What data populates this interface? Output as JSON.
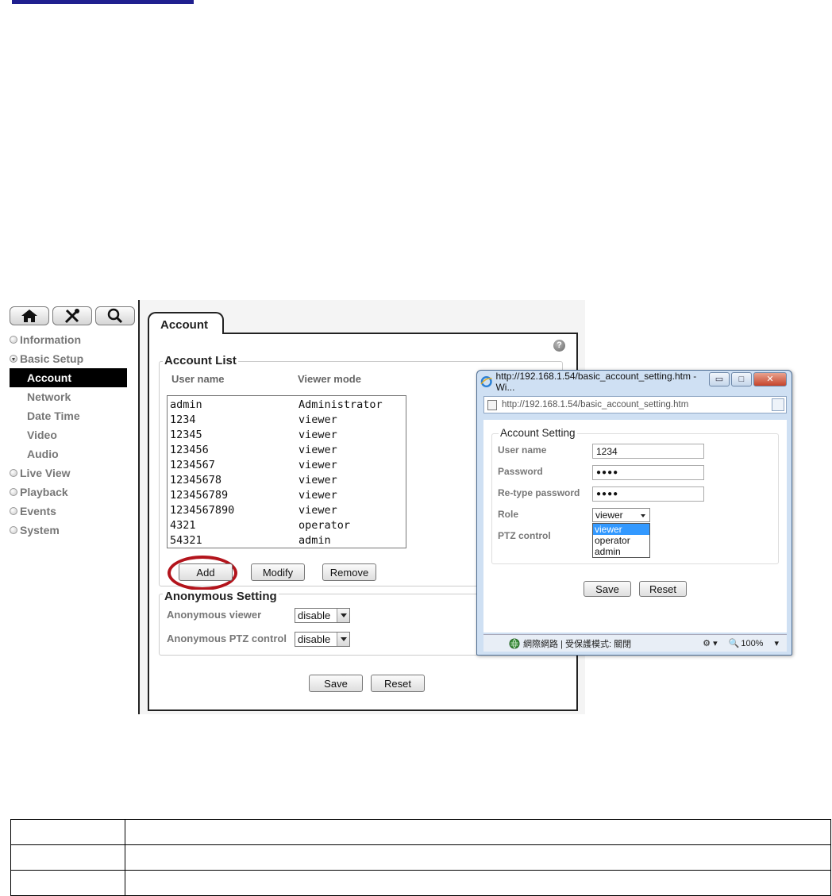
{
  "nav": {
    "icons": [
      "home-icon",
      "tools-icon",
      "search-icon"
    ],
    "items": [
      {
        "label": "Information",
        "type": "top"
      },
      {
        "label": "Basic Setup",
        "type": "open"
      },
      {
        "label": "Account",
        "type": "sub-active"
      },
      {
        "label": "Network",
        "type": "sub"
      },
      {
        "label": "Date Time",
        "type": "sub"
      },
      {
        "label": "Video",
        "type": "sub"
      },
      {
        "label": "Audio",
        "type": "sub"
      },
      {
        "label": "Live View",
        "type": "top"
      },
      {
        "label": "Playback",
        "type": "top"
      },
      {
        "label": "Events",
        "type": "top"
      },
      {
        "label": "System",
        "type": "top"
      }
    ]
  },
  "main": {
    "tab": "Account",
    "account_list": {
      "legend": "Account List",
      "col_user": "User name",
      "col_mode": "Viewer mode",
      "rows": [
        [
          "admin",
          "Administrator"
        ],
        [
          "1234",
          "viewer"
        ],
        [
          "12345",
          "viewer"
        ],
        [
          "123456",
          "viewer"
        ],
        [
          "1234567",
          "viewer"
        ],
        [
          "12345678",
          "viewer"
        ],
        [
          "123456789",
          "viewer"
        ],
        [
          "1234567890",
          "viewer"
        ],
        [
          "4321",
          "operator"
        ],
        [
          "54321",
          "admin"
        ]
      ],
      "add_label": "Add",
      "modify_label": "Modify",
      "remove_label": "Remove"
    },
    "anonymous": {
      "legend": "Anonymous Setting",
      "viewer_label": "Anonymous viewer",
      "viewer_value": "disable",
      "ptz_label": "Anonymous PTZ control",
      "ptz_value": "disable"
    },
    "save_label": "Save",
    "reset_label": "Reset"
  },
  "popup": {
    "title": "http://192.168.1.54/basic_account_setting.htm - Wi...",
    "address": "http://192.168.1.54/basic_account_setting.htm",
    "legend": "Account Setting",
    "username_label": "User name",
    "username_value": "1234",
    "password_label": "Password",
    "password_value": "●●●●",
    "retype_label": "Re-type password",
    "retype_value": "●●●●",
    "role_label": "Role",
    "role_value": "viewer",
    "role_options": [
      "viewer",
      "operator",
      "admin"
    ],
    "ptz_label": "PTZ control",
    "save_label": "Save",
    "reset_label": "Reset",
    "status_zone": "網際網路 | 受保護模式: 關閉",
    "zoom": "100%"
  },
  "colors": {
    "highlight_ring": "#b3141c",
    "nav_active_bg": "#000000",
    "dropdown_selected": "#3399ff"
  }
}
